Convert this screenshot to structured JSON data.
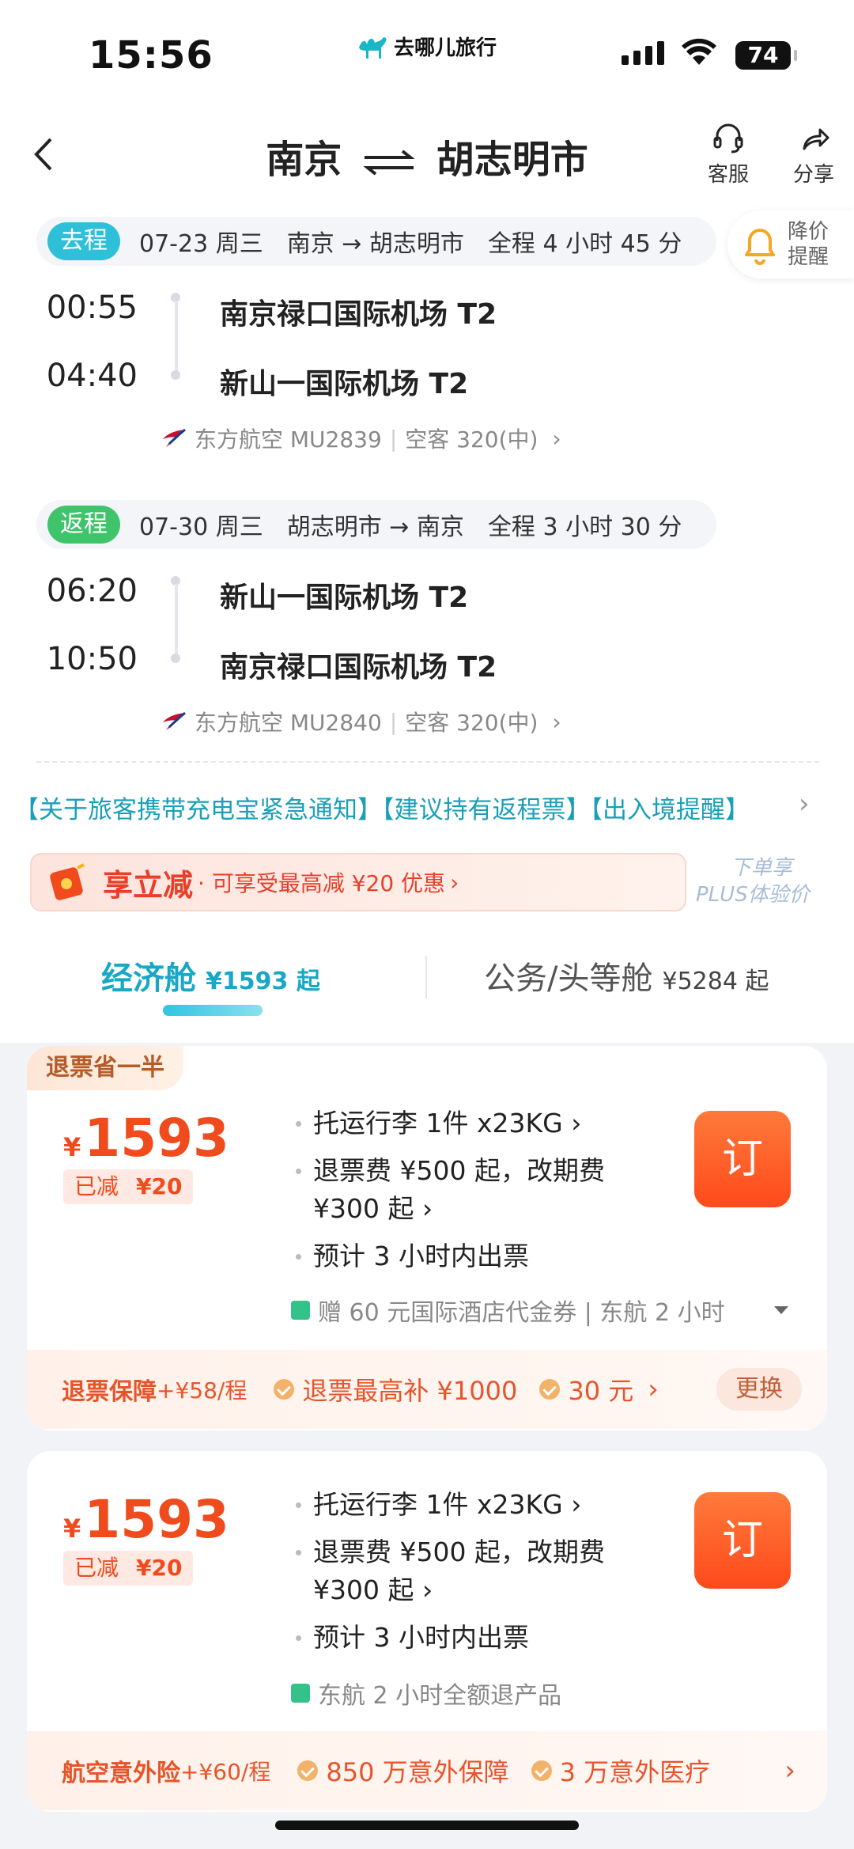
{
  "status": {
    "time": "15:56",
    "brand": "去哪儿旅行",
    "battery": "74"
  },
  "nav": {
    "title_from": "南京",
    "title_to": "胡志明市",
    "service_label": "客服",
    "share_label": "分享"
  },
  "price_alert": {
    "line1": "降价",
    "line2": "提醒"
  },
  "outbound": {
    "tag": "去程",
    "date": "07-23 周三",
    "route": "南京 → 胡志明市",
    "duration": "全程 4 小时 45 分",
    "dep_time": "00:55",
    "dep_airport": "南京禄口国际机场 T2",
    "arr_time": "04:40",
    "arr_airport": "新山一国际机场 T2",
    "airline": "东方航空 MU2839",
    "aircraft": "空客 320(中)"
  },
  "return": {
    "tag": "返程",
    "date": "07-30 周三",
    "route": "胡志明市 → 南京",
    "duration": "全程 3 小时 30 分",
    "dep_time": "06:20",
    "dep_airport": "新山一国际机场 T2",
    "arr_time": "10:50",
    "arr_airport": "南京禄口国际机场 T2",
    "airline": "东方航空 MU2840",
    "aircraft": "空客 320(中)"
  },
  "notice": "【关于旅客携带充电宝紧急通知】【建议持有返程票】【出入境提醒】",
  "promo": {
    "title": "享立减",
    "text": "· 可享受最高减 ¥20 优惠",
    "plus_line1": "下单享",
    "plus_line2": "PLUS体验价"
  },
  "tabs": [
    {
      "label": "经济舱",
      "price": "¥1593 起"
    },
    {
      "label": "公务/头等舱",
      "price": "¥5284 起"
    }
  ],
  "cards": [
    {
      "tag": "退票省一半",
      "currency": "¥",
      "price": "1593",
      "off_label": "已减",
      "off_value": "¥20",
      "rule1": "托运行李 1件 x23KG ›",
      "rule2": "退票费 ¥500 起，改期费",
      "rule2b": "¥300 起 ›",
      "rule3": "预计 3 小时内出票",
      "gift": "赠 60 元国际酒店代金券 | 东航 2 小时",
      "order_label": "订",
      "ins_title": "退票保障",
      "ins_price": "+¥58/程",
      "ins_item1": "退票最高补 ¥1000",
      "ins_item2": "30 元",
      "swap_label": "更换"
    },
    {
      "currency": "¥",
      "price": "1593",
      "off_label": "已减",
      "off_value": "¥20",
      "rule1": "托运行李 1件 x23KG ›",
      "rule2": "退票费 ¥500 起，改期费",
      "rule2b": "¥300 起 ›",
      "rule3": "预计 3 小时内出票",
      "gift": "东航 2 小时全额退产品",
      "order_label": "订",
      "ins_title": "航空意外险",
      "ins_price": "+¥60/程",
      "ins_item1": "850 万意外保障",
      "ins_item2": "3 万意外医疗"
    }
  ],
  "colors": {
    "accent": "#19a7c6",
    "price": "#f04b1d",
    "order": "#ff5a24"
  }
}
